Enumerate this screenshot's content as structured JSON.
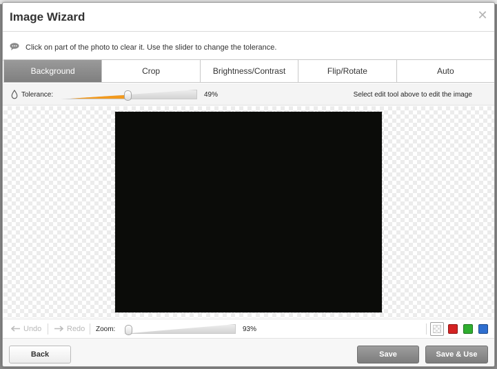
{
  "dialog": {
    "title": "Image Wizard",
    "instruction": "Click on part of the photo to clear it. Use the slider to change the tolerance."
  },
  "tabs": [
    {
      "label": "Background",
      "active": true
    },
    {
      "label": "Crop",
      "active": false
    },
    {
      "label": "Brightness/Contrast",
      "active": false
    },
    {
      "label": "Flip/Rotate",
      "active": false
    },
    {
      "label": "Auto",
      "active": false
    }
  ],
  "tolerance": {
    "label": "Tolerance:",
    "value": 49,
    "value_text": "49%",
    "hint": "Select edit tool above to edit the image"
  },
  "toolbar": {
    "undo_label": "Undo",
    "redo_label": "Redo",
    "zoom_label": "Zoom:",
    "zoom_value": 93,
    "zoom_text": "93%"
  },
  "background_colors": [
    {
      "name": "transparent",
      "color": "#ffffff"
    },
    {
      "name": "red",
      "color": "#d42222"
    },
    {
      "name": "green",
      "color": "#2fae2f"
    },
    {
      "name": "blue",
      "color": "#2f6fd0"
    }
  ],
  "footer": {
    "back_label": "Back",
    "save_label": "Save",
    "save_use_label": "Save & Use"
  },
  "colors": {
    "accent": "#f29a1e",
    "photo": "#0b0c09"
  }
}
